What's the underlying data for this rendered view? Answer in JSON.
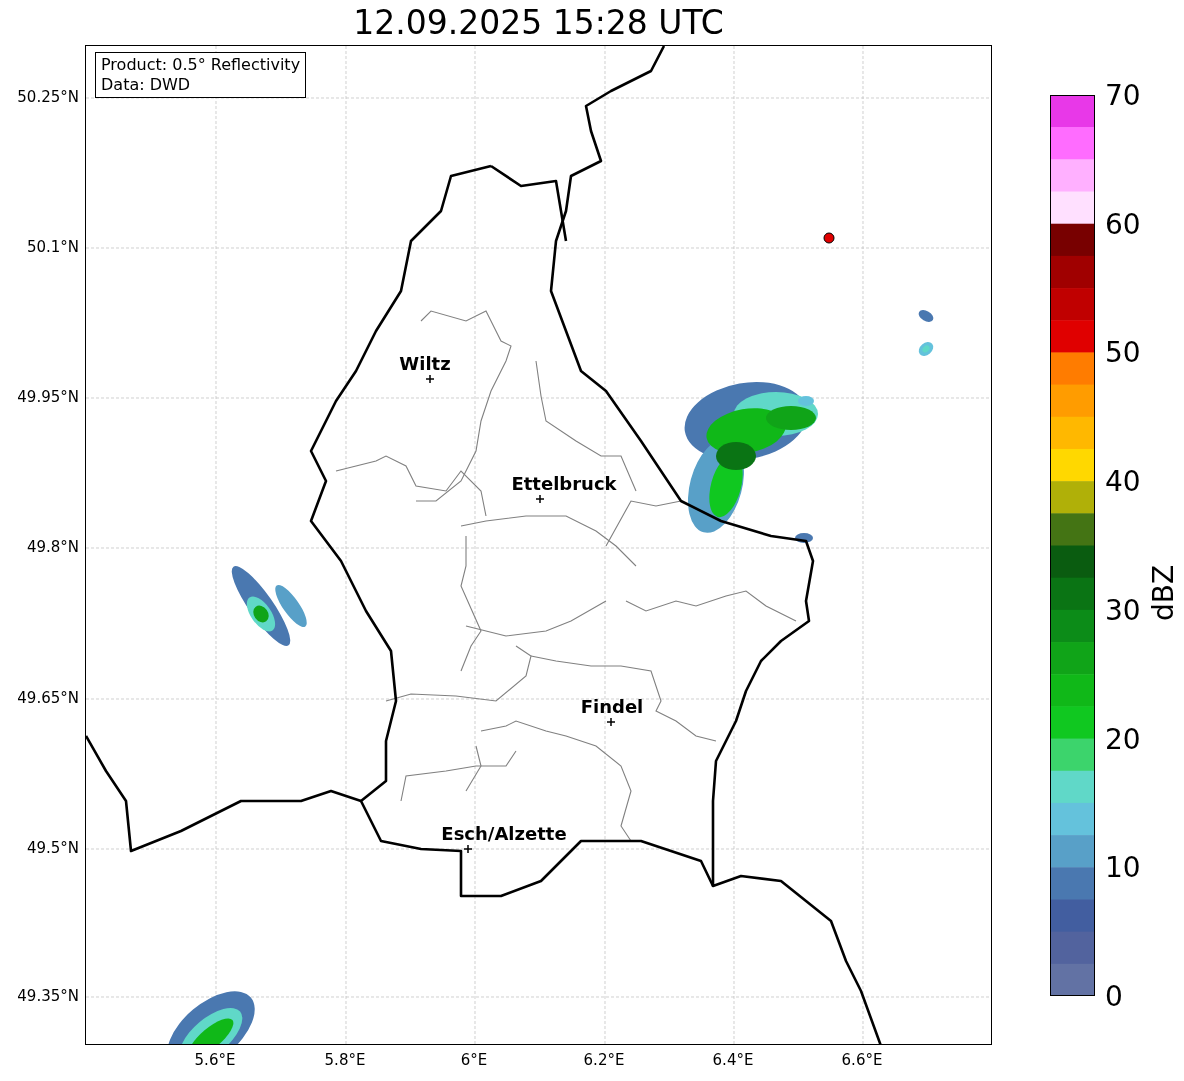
{
  "title": "12.09.2025 15:28 UTC",
  "info_box": [
    "Product: 0.5° Reflectivity",
    "Data: DWD"
  ],
  "map": {
    "yticks": [
      "50.25°N",
      "50.1°N",
      "49.95°N",
      "49.8°N",
      "49.65°N",
      "49.5°N",
      "49.35°N"
    ],
    "xticks": [
      "5.6°E",
      "5.8°E",
      "6°E",
      "6.2°E",
      "6.4°E",
      "6.6°E"
    ],
    "places": [
      {
        "name": "Wiltz"
      },
      {
        "name": "Ettelbruck"
      },
      {
        "name": "Findel"
      },
      {
        "name": "Esch/Alzette"
      }
    ]
  },
  "colorbar": {
    "label": "dBZ",
    "ticks": [
      "70",
      "60",
      "50",
      "40",
      "30",
      "20",
      "10",
      "0"
    ],
    "bands": [
      {
        "color": "#e838e8"
      },
      {
        "color": "#ff6cff"
      },
      {
        "color": "#ffb0ff"
      },
      {
        "color": "#ffe0ff"
      },
      {
        "color": "#780000"
      },
      {
        "color": "#a00000"
      },
      {
        "color": "#c00000"
      },
      {
        "color": "#e00000"
      },
      {
        "color": "#ff7c00"
      },
      {
        "color": "#ff9c00"
      },
      {
        "color": "#ffb800"
      },
      {
        "color": "#ffd800"
      },
      {
        "color": "#b0b008"
      },
      {
        "color": "#447414"
      },
      {
        "color": "#0a5c10"
      },
      {
        "color": "#0a7414"
      },
      {
        "color": "#0c8c18"
      },
      {
        "color": "#10a418"
      },
      {
        "color": "#10b818"
      },
      {
        "color": "#10c820"
      },
      {
        "color": "#3cd46c"
      },
      {
        "color": "#60d8c8"
      },
      {
        "color": "#64c2dc"
      },
      {
        "color": "#58a0c8"
      },
      {
        "color": "#4a78b0"
      },
      {
        "color": "#425ea0"
      },
      {
        "color": "#52639e"
      },
      {
        "color": "#6272a4"
      }
    ]
  }
}
